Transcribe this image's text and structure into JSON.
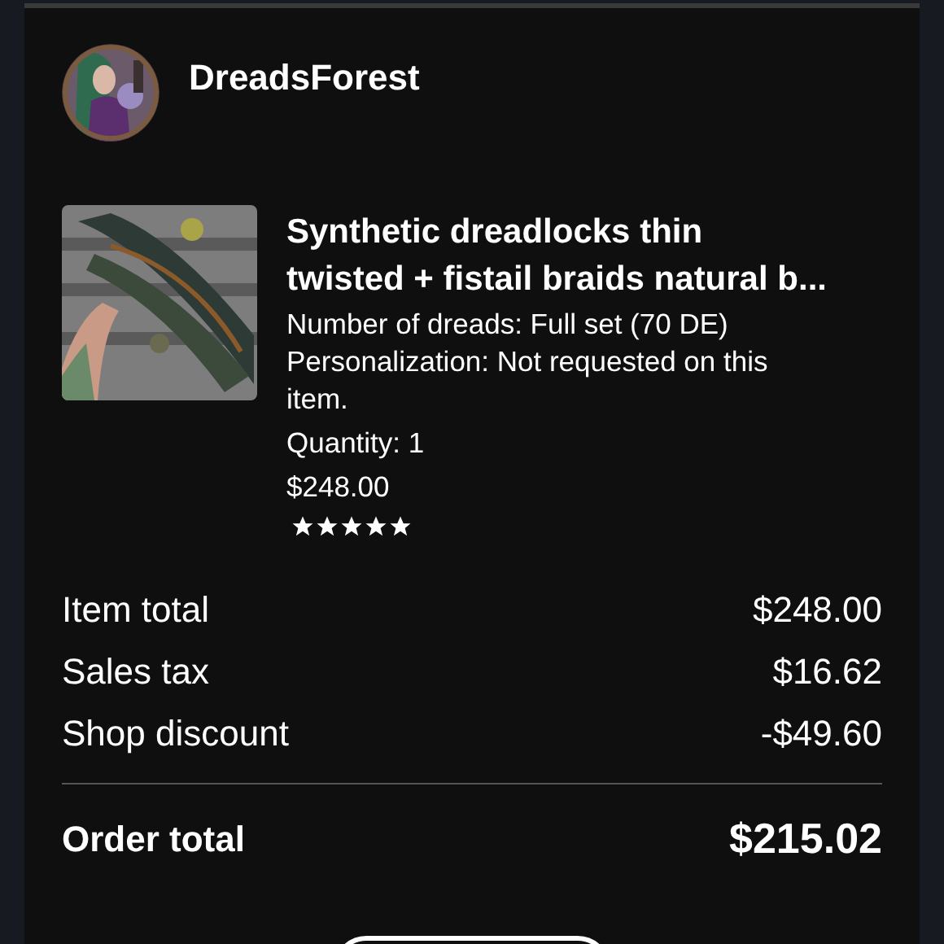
{
  "shop": {
    "name": "DreadsForest"
  },
  "item": {
    "title_lines": [
      "Synthetic dreadlocks thin",
      "twisted + fistail braids natural b..."
    ],
    "details": [
      "Number of dreads: Full set (70 DE)",
      "Personalization: Not requested on this item.",
      "Quantity: 1",
      "$248.00"
    ],
    "stars": 5
  },
  "summary": [
    {
      "label": "Item total",
      "value": "$248.00"
    },
    {
      "label": "Sales tax",
      "value": "$16.62"
    },
    {
      "label": "Shop discount",
      "value": "-$49.60"
    }
  ],
  "total": {
    "label": "Order total",
    "value": "$215.02"
  }
}
